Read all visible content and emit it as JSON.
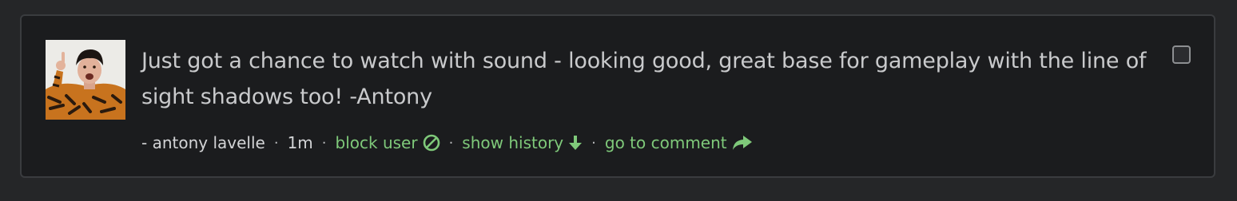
{
  "comment": {
    "text": "Just got a chance to watch with sound - looking good, great base for gameplay with the line of sight shadows too! -Antony",
    "author": "- antony lavelle",
    "age": "1m",
    "separator": "·"
  },
  "actions": {
    "block_user": {
      "label": "block user",
      "icon": "block-icon"
    },
    "show_history": {
      "label": "show history",
      "icon": "arrow-down-icon"
    },
    "go_to_comment": {
      "label": "go to comment",
      "icon": "share-arrow-icon"
    }
  },
  "select": {
    "checked": false
  },
  "colors": {
    "page_background": "#252628",
    "card_background": "#1b1c1e",
    "card_border": "#3a3c3f",
    "text": "#c9cacc",
    "link": "#7fc97a"
  }
}
